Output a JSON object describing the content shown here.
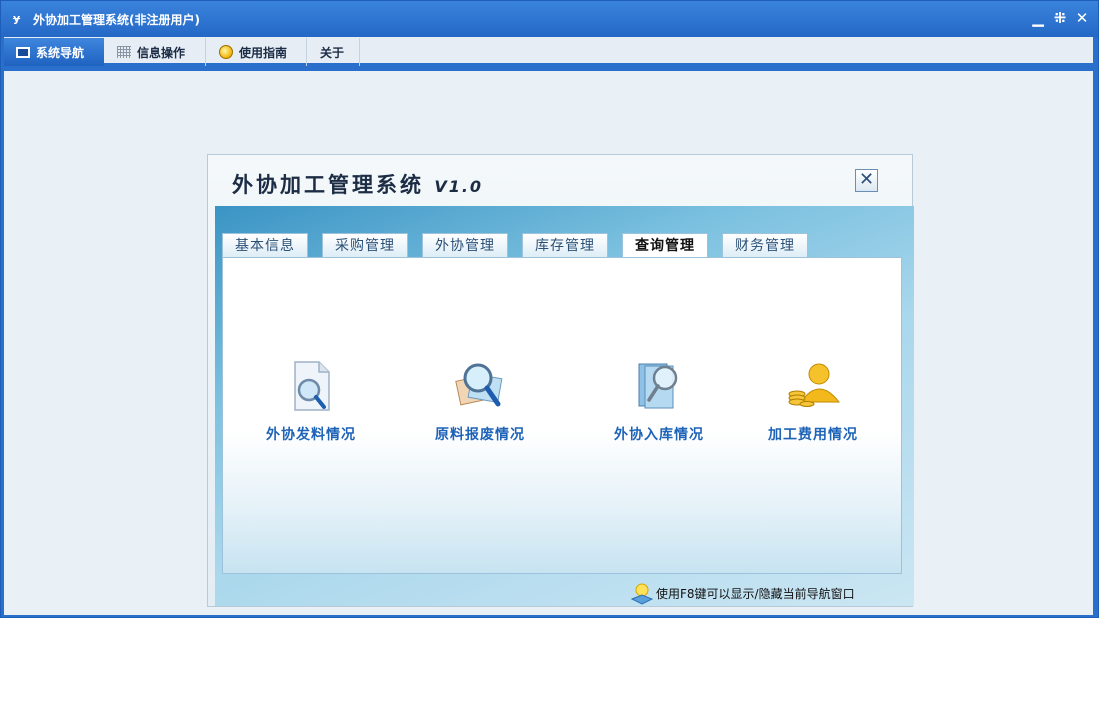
{
  "window": {
    "title": "外协加工管理系统(非注册用户)"
  },
  "window_buttons": {
    "minimize": "▁",
    "restore": "⁜",
    "close": "✕"
  },
  "menu": [
    {
      "label": "系统导航",
      "icon": "monitor-icon",
      "active": true
    },
    {
      "label": "信息操作",
      "icon": "grid-icon",
      "active": false
    },
    {
      "label": "使用指南",
      "icon": "bulb-icon",
      "active": false
    },
    {
      "label": "关于",
      "icon": "",
      "active": false
    }
  ],
  "dialog": {
    "title": "外协加工管理系统",
    "version": "V1.0",
    "close_label": "✕",
    "tabs": [
      {
        "label": "基本信息",
        "active": false
      },
      {
        "label": "采购管理",
        "active": false
      },
      {
        "label": "外协管理",
        "active": false
      },
      {
        "label": "库存管理",
        "active": false
      },
      {
        "label": "查询管理",
        "active": true
      },
      {
        "label": "财务管理",
        "active": false
      }
    ],
    "functions": [
      {
        "label": "外协发料情况",
        "icon": "magnifier-document-icon"
      },
      {
        "label": "原料报废情况",
        "icon": "magnifier-photos-icon"
      },
      {
        "label": "外协入库情况",
        "icon": "magnifier-book-icon"
      },
      {
        "label": "加工费用情况",
        "icon": "user-coins-icon"
      }
    ],
    "hint": "使用F8键可以显示/隐藏当前导航窗口"
  },
  "colors": {
    "title_blue": "#2a6fcc",
    "function_text": "#1d63b8"
  }
}
